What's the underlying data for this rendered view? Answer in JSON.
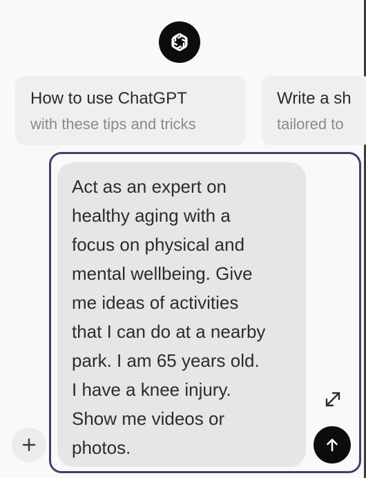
{
  "app": {
    "logo_icon": "openai-logo-icon"
  },
  "suggestions": [
    {
      "title": "How to use ChatGPT",
      "subtitle": "with these tips and tricks"
    },
    {
      "title": "Write a sh",
      "subtitle": "tailored to"
    }
  ],
  "composer": {
    "message": "Act as an expert on\nhealthy aging with a\nfocus on physical and\nmental wellbeing. Give\nme ideas of activities\nthat I can do at a nearby\npark. I am 65 years old.\nI have a knee injury.\nShow me videos or\nphotos.",
    "add_icon": "plus-icon",
    "expand_icon": "expand-icon",
    "send_icon": "arrow-up-icon"
  },
  "colors": {
    "focus_border": "#4a3a6a",
    "send_button": "#0d0d0d",
    "bubble": "#e6e6e6"
  }
}
